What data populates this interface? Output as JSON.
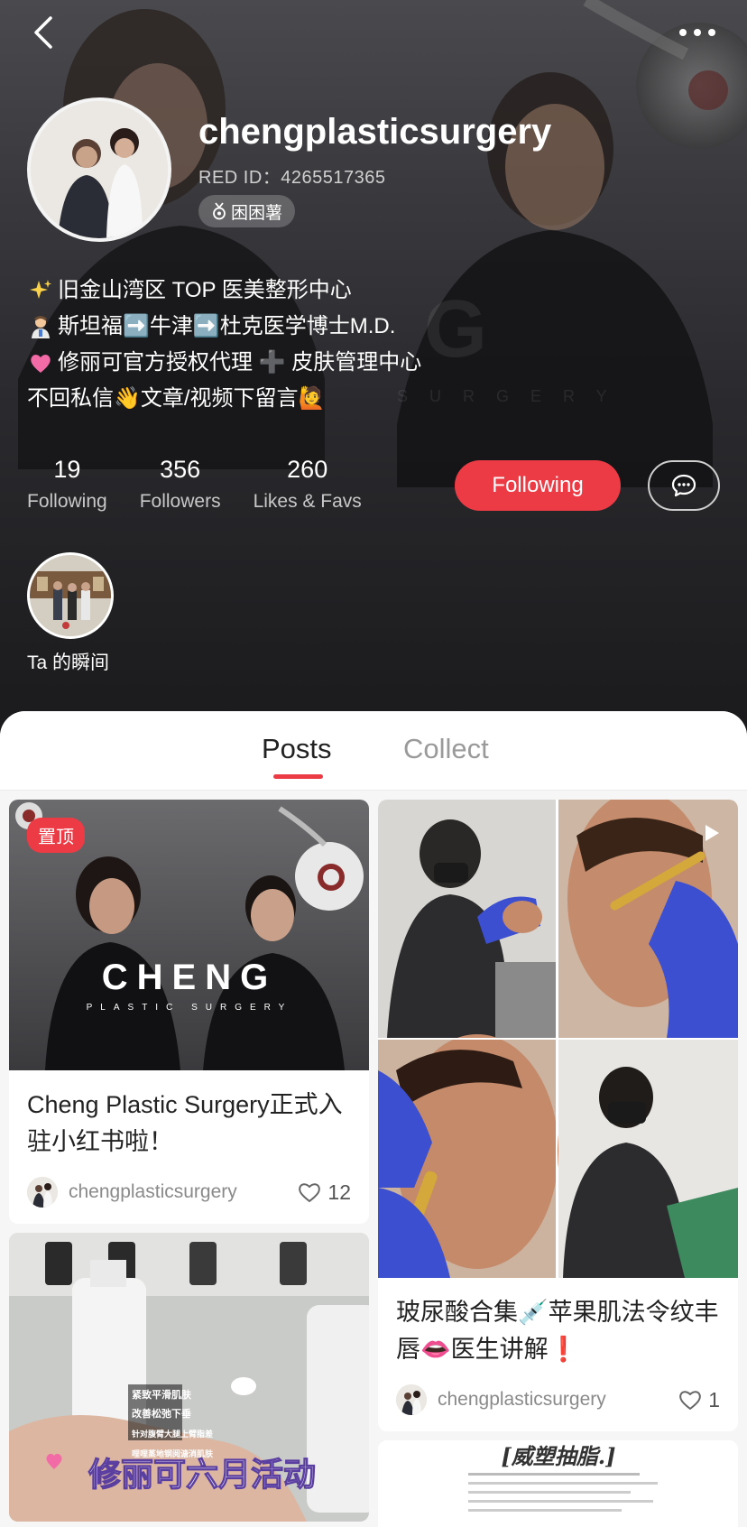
{
  "profile": {
    "username": "chengplasticsurgery",
    "red_id": "RED ID：4265517365",
    "badge": "困困薯",
    "bio": [
      {
        "icon": "sparkles-icon",
        "text": "旧金山湾区 TOP 医美整形中心"
      },
      {
        "icon": "doctor-icon",
        "text": "斯坦福➡️牛津➡️杜克医学博士M.D."
      },
      {
        "icon": "heart-icon",
        "text": "修丽可官方授权代理 ➕ 皮肤管理中心"
      },
      {
        "icon": "",
        "text": "不回私信👋文章/视频下留言🙋"
      }
    ],
    "stats": [
      {
        "value": "19",
        "label": "Following"
      },
      {
        "value": "356",
        "label": "Followers"
      },
      {
        "value": "260",
        "label": "Likes & Favs"
      }
    ],
    "follow_label": "Following",
    "moment_label": "Ta 的瞬间"
  },
  "tabs": {
    "posts": "Posts",
    "collect": "Collect"
  },
  "posts": [
    {
      "pin": "置顶",
      "banner": "CHENG",
      "banner_sub": "PLASTIC SURGERY",
      "title": "Cheng Plastic Surgery正式入驻小红书啦！",
      "author": "chengplasticsurgery",
      "likes": "12"
    },
    {
      "title": "玻尿酸合集💉苹果肌法令纹丰唇👄医生讲解❗",
      "author": "chengplasticsurgery",
      "likes": "1"
    },
    {
      "overlay": "修丽可六月活动",
      "lines": [
        "紧致平滑肌肤",
        "改善松弛下垂",
        "针对腹臂大腿上臂脂差",
        "哩哩蒸地钢阅溏消肌肤"
      ]
    },
    {
      "overlay_title": "[威塑抽脂.]"
    }
  ],
  "colors": {
    "accent": "#ec3b45"
  }
}
